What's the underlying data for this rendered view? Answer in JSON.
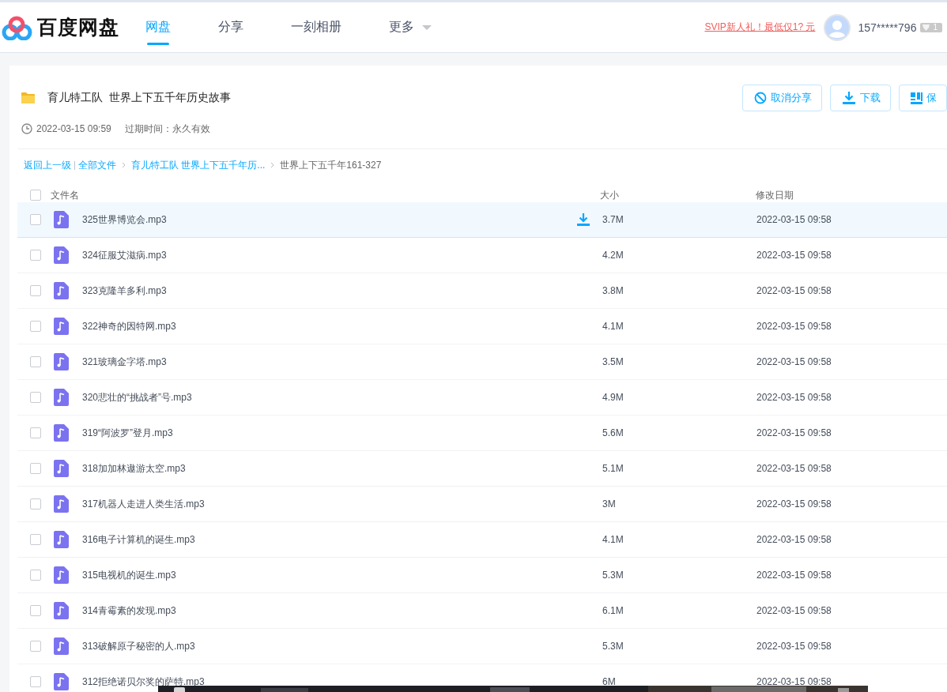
{
  "header": {
    "logo_text": "百度网盘",
    "nav": [
      {
        "label": "网盘",
        "selected": true,
        "kind": "link"
      },
      {
        "label": "分享",
        "selected": false,
        "kind": "link"
      },
      {
        "label": "一刻相册",
        "selected": false,
        "kind": "link"
      },
      {
        "label": "更多",
        "selected": false,
        "kind": "menu"
      }
    ],
    "promo": "SVIP新人礼！最低仅1? 元",
    "user": {
      "name": "157*****796",
      "vip_badge": "1"
    }
  },
  "share": {
    "title": "育儿特工队  世界上下五千年历史故事",
    "created": "2022-03-15 09:59",
    "expiry": "过期时间：永久有效",
    "buttons": [
      {
        "label": "取消分享",
        "kind": "cancel"
      },
      {
        "label": "下载",
        "kind": "download"
      },
      {
        "label": "保",
        "kind": "save"
      }
    ]
  },
  "breadcrumb": {
    "back": "返回上一级",
    "items": [
      {
        "label": "全部文件",
        "kind": "link"
      },
      {
        "label": "育儿特工队 世界上下五千年历...",
        "kind": "link"
      },
      {
        "label": "世界上下五千年161-327",
        "kind": "current"
      }
    ]
  },
  "table": {
    "columns": [
      "文件名",
      "大小",
      "修改日期"
    ],
    "all_checked": false,
    "rows": [
      {
        "name": "325世界博览会.mp3",
        "size": "3.7M",
        "date": "2022-03-15 09:58",
        "checked": false,
        "highlighted": true
      },
      {
        "name": "324征服艾滋病.mp3",
        "size": "4.2M",
        "date": "2022-03-15 09:58",
        "checked": false,
        "highlighted": false
      },
      {
        "name": "323克隆羊多利.mp3",
        "size": "3.8M",
        "date": "2022-03-15 09:58",
        "checked": false,
        "highlighted": false
      },
      {
        "name": "322神奇的因特网.mp3",
        "size": "4.1M",
        "date": "2022-03-15 09:58",
        "checked": false,
        "highlighted": false
      },
      {
        "name": "321玻璃金字塔.mp3",
        "size": "3.5M",
        "date": "2022-03-15 09:58",
        "checked": false,
        "highlighted": false
      },
      {
        "name": "320悲壮的“挑战者”号.mp3",
        "size": "4.9M",
        "date": "2022-03-15 09:58",
        "checked": false,
        "highlighted": false
      },
      {
        "name": "319“阿波罗”登月.mp3",
        "size": "5.6M",
        "date": "2022-03-15 09:58",
        "checked": false,
        "highlighted": false
      },
      {
        "name": "318加加林遨游太空.mp3",
        "size": "5.1M",
        "date": "2022-03-15 09:58",
        "checked": false,
        "highlighted": false
      },
      {
        "name": "317机器人走进人类生活.mp3",
        "size": "3M",
        "date": "2022-03-15 09:58",
        "checked": false,
        "highlighted": false
      },
      {
        "name": "316电子计算机的诞生.mp3",
        "size": "4.1M",
        "date": "2022-03-15 09:58",
        "checked": false,
        "highlighted": false
      },
      {
        "name": "315电视机的诞生.mp3",
        "size": "5.3M",
        "date": "2022-03-15 09:58",
        "checked": false,
        "highlighted": false
      },
      {
        "name": "314青霉素的发现.mp3",
        "size": "6.1M",
        "date": "2022-03-15 09:58",
        "checked": false,
        "highlighted": false
      },
      {
        "name": "313破解原子秘密的人.mp3",
        "size": "5.3M",
        "date": "2022-03-15 09:58",
        "checked": false,
        "highlighted": false
      },
      {
        "name": "312拒绝诺贝尔奖的萨特.mp3",
        "size": "6M",
        "date": "2022-03-15 09:58",
        "checked": false,
        "highlighted": false
      }
    ]
  }
}
